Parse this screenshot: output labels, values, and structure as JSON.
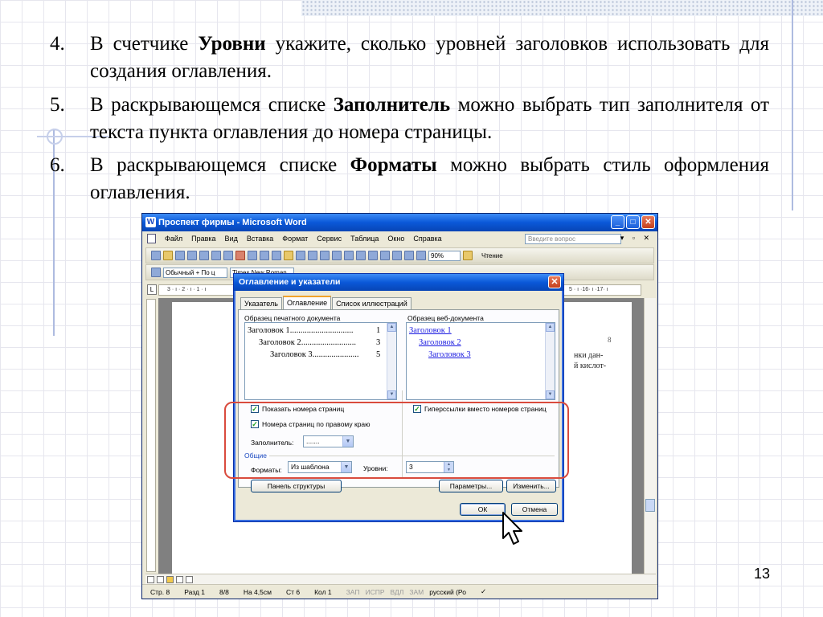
{
  "slide": {
    "items": [
      {
        "num": "4.",
        "before": "В счетчике ",
        "bold": "Уровни",
        "after": " укажите, сколько уровней заголовков использовать для создания оглавления."
      },
      {
        "num": "5.",
        "before": "В раскрывающемся списке ",
        "bold": "Заполнитель",
        "after": " можно выбрать тип заполнителя от текста пункта оглавления до номера страницы."
      },
      {
        "num": "6.",
        "before": "В раскрывающемся списке ",
        "bold": "Форматы",
        "after": " можно выбрать стиль оформления оглавления."
      }
    ],
    "page_number": "13"
  },
  "word": {
    "title": "Проспект фирмы - Microsoft Word",
    "menu": [
      "Файл",
      "Правка",
      "Вид",
      "Вставка",
      "Формат",
      "Сервис",
      "Таблица",
      "Окно",
      "Справка"
    ],
    "ask_placeholder": "Введите вопрос",
    "zoom": "90%",
    "read_label": "Чтение",
    "style_value": "Обычный + По ц",
    "font_value": "Times New Roman",
    "ruler_left": "3 · ı · 2 · ı · 1 · ı",
    "ruler_right": "5 · ı ·16· ı ·17· ı",
    "page_marker": "8",
    "page_text_1": "нки дан-",
    "page_text_2": "й кислот-",
    "status": {
      "page": "Стр. 8",
      "section": "Разд 1",
      "pages": "8/8",
      "at": "На 4,5см",
      "line": "Ст 6",
      "col": "Кол 1",
      "rec": "ЗАП",
      "trk": "ИСПР",
      "ext": "ВДЛ",
      "ovr": "ЗАМ",
      "lang": "русский (Ро"
    }
  },
  "dialog": {
    "title": "Оглавление и указатели",
    "tabs": [
      "Указатель",
      "Оглавление",
      "Список иллюстраций"
    ],
    "print_preview_label": "Образец печатного документа",
    "web_preview_label": "Образец веб-документа",
    "print_rows": [
      {
        "text": "Заголовок 1",
        "dots": "..............................",
        "page": "1"
      },
      {
        "text": "Заголовок 2",
        "dots": "..........................",
        "page": "3"
      },
      {
        "text": "Заголовок 3",
        "dots": "......................",
        "page": "5"
      }
    ],
    "web_rows": [
      "Заголовок 1",
      "Заголовок 2",
      "Заголовок 3"
    ],
    "show_page_numbers": "Показать номера страниц",
    "right_align": "Номера страниц по правому краю",
    "hyperlinks": "Гиперссылки вместо номеров страниц",
    "leader_label": "Заполнитель:",
    "leader_value": ".......",
    "general_label": "Общие",
    "formats_label": "Форматы:",
    "formats_value": "Из шаблона",
    "levels_label": "Уровни:",
    "levels_value": "3",
    "outline_button": "Панель структуры",
    "options_button": "Параметры...",
    "modify_button": "Изменить...",
    "ok_button": "ОК",
    "cancel_button": "Отмена"
  },
  "colors": {
    "highlight_frame": "#d94b3d",
    "title_bar": "#0a58d8",
    "link": "#1a1ae0"
  }
}
